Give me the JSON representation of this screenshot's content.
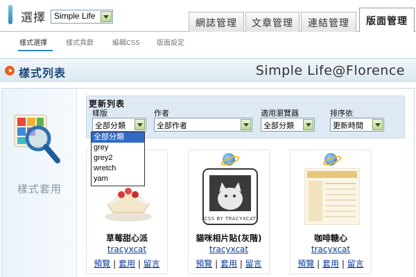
{
  "header": {
    "select_label": "選擇",
    "blog_select_value": "Simple Life",
    "tabs": [
      {
        "label": "網誌管理"
      },
      {
        "label": "文章管理"
      },
      {
        "label": "連結管理"
      },
      {
        "label": "版面管理"
      }
    ]
  },
  "subnav": {
    "items": [
      {
        "label": "樣式選擇"
      },
      {
        "label": "樣式貢獻"
      },
      {
        "label": "編輯CSS"
      },
      {
        "label": "版面設定"
      }
    ]
  },
  "band": {
    "title": "樣式列表",
    "brand": "Simple Life@Florence"
  },
  "left_panel": {
    "label": "樣式套用",
    "icon": "magnifier-palette-icon"
  },
  "filters": {
    "title": "更新列表",
    "fields": [
      {
        "label": "樣版",
        "value": "全部分類"
      },
      {
        "label": "作者",
        "value": "全部作者"
      },
      {
        "label": "適用瀏覽器",
        "value": "全部分類"
      },
      {
        "label": "排序依",
        "value": "更新時間"
      }
    ],
    "dropdown_options": [
      "全部分類",
      "grey",
      "grey2",
      "wretch",
      "yam"
    ],
    "dropdown_selected": "全部分類"
  },
  "cards": [
    {
      "name": "草莓甜心派",
      "author": "tracyxcat",
      "preview": "預覽",
      "apply": "套用",
      "comment": "留言"
    },
    {
      "name": "貓咪相片貼(灰階)",
      "author": "tracyxcat",
      "preview": "預覽",
      "apply": "套用",
      "comment": "留言",
      "thumb_caption": "CSS BY TRACYXCAT"
    },
    {
      "name": "咖啡糖心",
      "author": "tracyxcat",
      "preview": "預覽",
      "apply": "套用",
      "comment": "留言"
    }
  ],
  "colors": {
    "accent": "#2a86be",
    "band_title": "#1f4a78",
    "link": "#0b3c9a",
    "selection": "#316ac5"
  }
}
